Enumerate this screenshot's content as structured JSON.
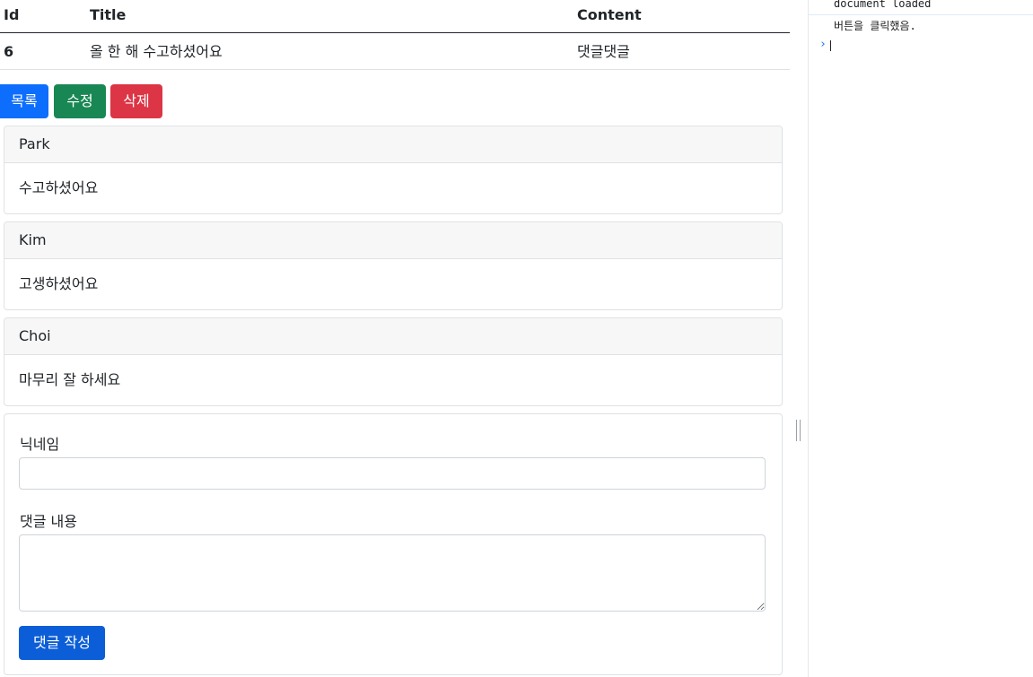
{
  "table": {
    "headers": {
      "id": "Id",
      "title": "Title",
      "content": "Content"
    },
    "row": {
      "id": "6",
      "title": "올 한 해 수고하셨어요",
      "content": "댓글댓글"
    }
  },
  "actions": {
    "list_label": "목록",
    "edit_label": "수정",
    "delete_label": "삭제"
  },
  "comments": [
    {
      "author": "Park",
      "text": "수고하셨어요"
    },
    {
      "author": "Kim",
      "text": "고생하셨어요"
    },
    {
      "author": "Choi",
      "text": "마무리 잘 하세요"
    }
  ],
  "form": {
    "nickname_label": "닉네임",
    "nickname_value": "",
    "content_label": "댓글 내용",
    "content_value": "",
    "submit_label": "댓글 작성"
  },
  "console": {
    "lines": [
      "document loaded",
      "버튼을 클릭했음."
    ],
    "prompt": "›"
  },
  "colors": {
    "primary": "#0d6efd",
    "success": "#198754",
    "danger": "#dc3545",
    "submit": "#0b5ed7"
  }
}
